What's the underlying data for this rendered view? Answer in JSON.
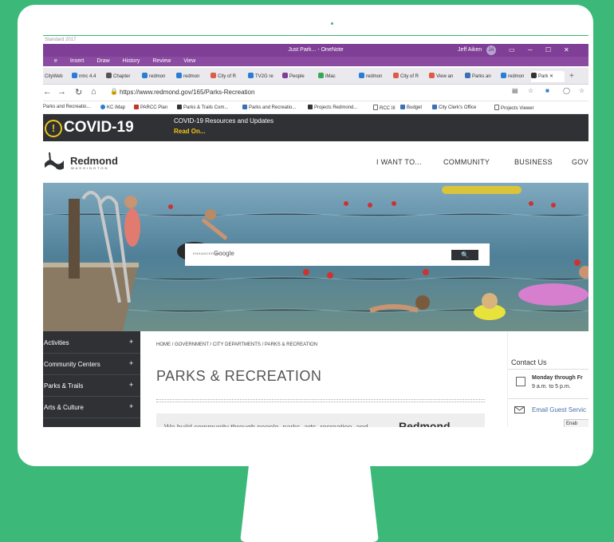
{
  "colors": {
    "background": "#3cb878",
    "titlebar": "#7f3f96",
    "dark": "#2f3134",
    "accent": "#f0c419"
  },
  "app": {
    "strip_text": "Standard 2017",
    "title": "Just Park... - OneNote",
    "user": "Jeff Aiken",
    "initials": "JA",
    "menu": [
      "e",
      "Insert",
      "Draw",
      "History",
      "Review",
      "View"
    ]
  },
  "browser": {
    "tabs": [
      "CityWeb",
      "nmc 4.4",
      "Chapter",
      "redmon",
      "redmon",
      "City of R",
      "TV2G re",
      "People",
      "iMac",
      "redmon",
      "City of R",
      "View an",
      "Parks an",
      "redmon",
      "Park"
    ],
    "url": "https://www.redmond.gov/165/Parks-Recreation",
    "favorites": [
      "Parks and Recreatio...",
      "KC iMap",
      "PARCC Plan",
      "Parks & Trails Com...",
      "Parks and Recreatio...",
      "Projects Redmond...",
      "RCC III",
      "Budget",
      "City Clerk's Office",
      "Projects Viewer"
    ]
  },
  "covid": {
    "title": "COVID-19",
    "resources": "COVID-19 Resources and Updates",
    "read_on": "Read On..."
  },
  "site": {
    "brand": "Redmond",
    "brand_sub": "WASHINGTON",
    "nav": [
      "I WANT TO...",
      "COMMUNITY",
      "BUSINESS",
      "GOV"
    ]
  },
  "search": {
    "powered_by": "ENHANCED BY",
    "google": "Google"
  },
  "sidebar": {
    "items": [
      {
        "label": "Activities"
      },
      {
        "label": "Community Centers"
      },
      {
        "label": "Parks & Trails"
      },
      {
        "label": "Arts & Culture"
      }
    ],
    "plus": "+"
  },
  "main": {
    "breadcrumb": "HOME / GOVERNMENT / CITY DEPARTMENTS / PARKS & RECREATION",
    "title": "PARKS & RECREATION",
    "intro": "We build community through people, parks, arts, recreation, and",
    "intro_brand": "Redmond"
  },
  "contact": {
    "title": "Contact Us",
    "hours_days": "Monday through Fr",
    "hours_time": "9 a.m. to 5 p.m.",
    "email_link": "Email Guest Servic",
    "enable_label": "Enab"
  }
}
